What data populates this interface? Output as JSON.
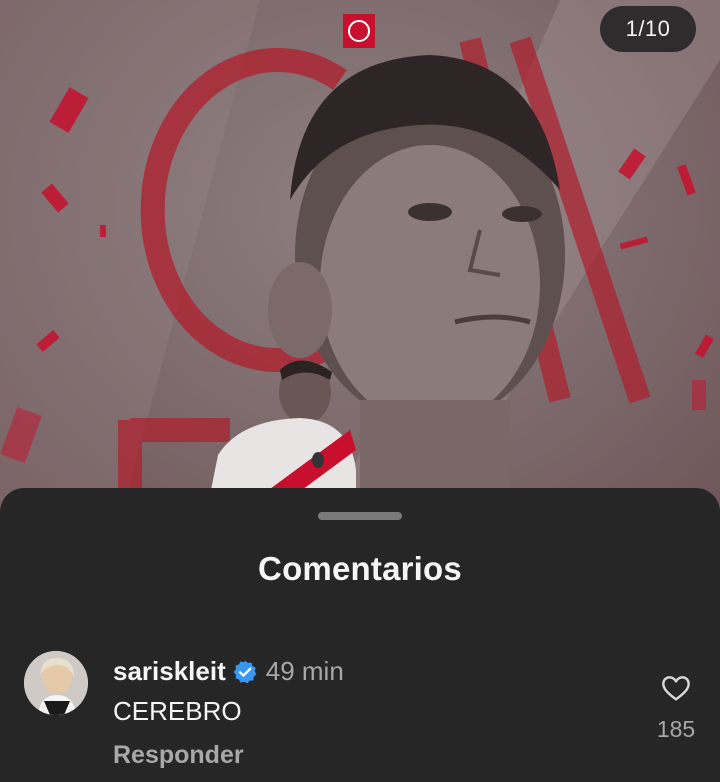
{
  "post": {
    "counter": "1/10",
    "image_description_icon": "player-photo"
  },
  "sheet": {
    "title": "Comentarios"
  },
  "comments": [
    {
      "username": "sariskleit",
      "verified": true,
      "time": "49 min",
      "text": "CEREBRO",
      "reply_label": "Responder",
      "likes": "185"
    }
  ],
  "colors": {
    "sheet_background": "#262626",
    "primary_text": "#f5f5f5",
    "secondary_text": "#a8a8a8",
    "verified_blue": "#3897f0",
    "accent_red": "#c8102e"
  }
}
